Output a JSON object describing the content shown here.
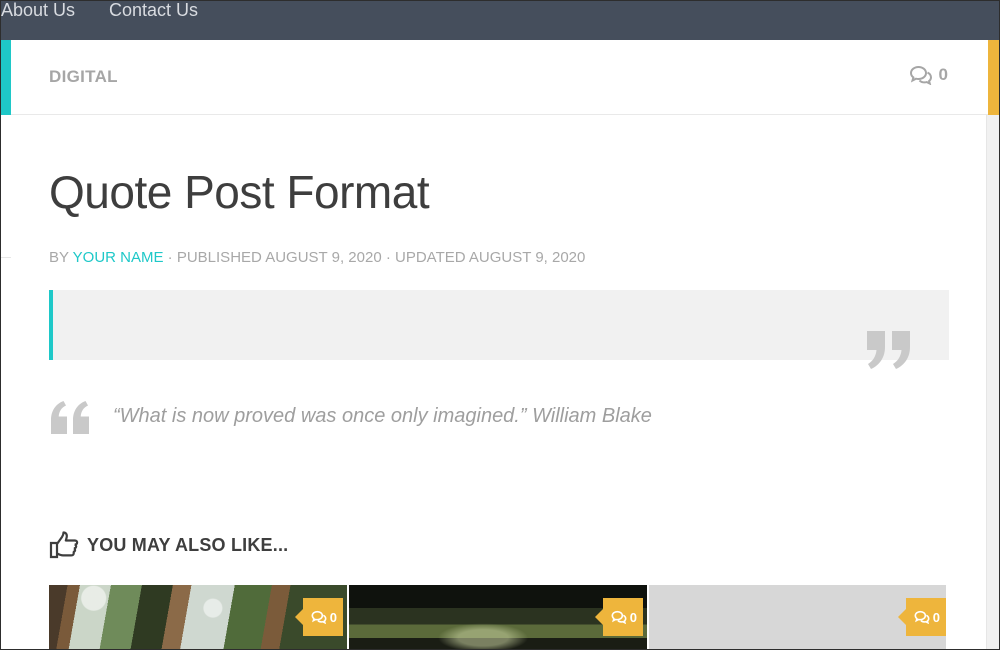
{
  "nav": {
    "items": [
      {
        "label": "About Us"
      },
      {
        "label": "Contact Us"
      }
    ]
  },
  "category": {
    "label": "DIGITAL",
    "comment_count": "0",
    "comment_icon": "comments-icon"
  },
  "post": {
    "title": "Quote Post Format",
    "byline": {
      "by": "BY",
      "author": "YOUR NAME",
      "published_label": "· PUBLISHED",
      "published_date": "AUGUST 9, 2020",
      "updated_label": "· UPDATED",
      "updated_date": "AUGUST 9, 2020"
    },
    "quote_text": "“What is now proved was once only imagined.” William Blake"
  },
  "related": {
    "heading": "YOU MAY ALSO LIKE...",
    "heading_icon": "thumbs-up-pointing-icon",
    "cards": [
      {
        "comments": "0",
        "thumbnail": "forest-canopy"
      },
      {
        "comments": "0",
        "thumbnail": "dark-vehicle-interior"
      },
      {
        "comments": "0",
        "thumbnail": "gray-placeholder"
      }
    ]
  },
  "colors": {
    "accent_teal": "#1ec8c8",
    "accent_gold": "#eeb53c",
    "nav_bg": "#454e5c",
    "text_dark": "#3e3e3e",
    "text_muted": "#a6a6a6"
  }
}
